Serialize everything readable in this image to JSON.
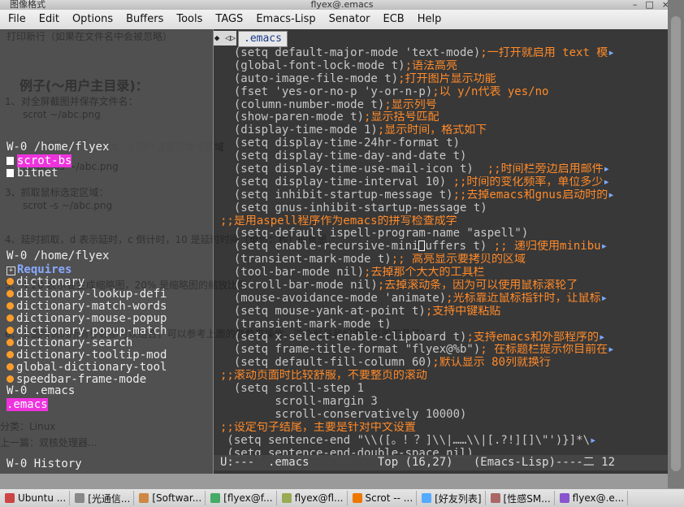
{
  "window": {
    "app_title": "图像格式",
    "title": "flyex@.emacs"
  },
  "menubar": {
    "items": [
      "File",
      "Edit",
      "Options",
      "Buffers",
      "Tools",
      "TAGS",
      "Emacs-Lisp",
      "Senator",
      "ECB",
      "Help"
    ]
  },
  "background": {
    "lines": [
      "打印新行（如果在文件名中会被忽略）",
      "例子(～用户主目录)：",
      "1、对全屏截图并保存文件名：",
      "scrot ~/abc.png",
      "2、截取窗口或带边框窗体，s 用户选择窗体或区域",
      "scrot -bs ~/abc.png",
      "3、抓取鼠标选定区域：",
      "scrot -s ~/abc.png",
      "4、延时抓取，d 表示延时，c 倒计时，10 是延时时间（单位：秒）的意思",
      "5、-t 20 表示要生成缩略图，20% 是缩略图的缩放比例",
      "6、上面所说的所有参数都可以组合，可以参考上面的参数来操作，这个就是我们要的截图工具了！",
      "分类：Linux",
      "上一篇：双核处理器..."
    ]
  },
  "speedbar": {
    "dir_modeline": "W-0 /home/flyex",
    "files": [
      "scrot-bs",
      "bitnet"
    ],
    "dir_modeline2": "W-0 /home/flyex",
    "requires_label": "Requires",
    "requires": [
      "dictionary",
      "dictionary-lookup-defi",
      "dictionary-match-words",
      "dictionary-mouse-popup",
      "dictionary-popup-match",
      "dictionary-search",
      "dictionary-tooltip-mod",
      "global-dictionary-tool",
      "speedbar-frame-mode"
    ],
    "emacs_modeline": "W-0 .emacs",
    "emacs_selected": ".emacs",
    "history_modeline": "W-0 History"
  },
  "editor": {
    "tab_arrows": "◆ ◁▷",
    "buffer_tab": ".emacs",
    "trunc_mark": "▸",
    "lines": [
      {
        "code": "  (setq default-major-mode 'text-mode)",
        "comment": ";一打开就启用 text 模",
        "trunc": true
      },
      {
        "code": "  (global-font-lock-mode t)",
        "comment": ";语法高亮"
      },
      {
        "code": "  (auto-image-file-mode t)",
        "comment": ";打开图片显示功能"
      },
      {
        "code": "  (fset 'yes-or-no-p 'y-or-n-p)",
        "comment": ";以 y/n代表 yes/no"
      },
      {
        "code": "  (column-number-mode t)",
        "comment": ";显示列号"
      },
      {
        "code": "  (show-paren-mode t)",
        "comment": ";显示括号匹配"
      },
      {
        "code": "  (display-time-mode 1)",
        "comment": ";显示时间，格式如下"
      },
      {
        "code": "  (setq display-time-24hr-format t)",
        "comment": ""
      },
      {
        "code": "  (setq display-time-day-and-date t)",
        "comment": ""
      },
      {
        "code": "  (setq display-time-use-mail-icon t)  ",
        "comment": ";;时间栏旁边启用邮件",
        "trunc": true
      },
      {
        "code": "  (setq display-time-interval 10) ",
        "comment": ";;时间的变化频率，单位多少",
        "trunc": true
      },
      {
        "code": "  (setq inhibit-startup-message t)",
        "comment": ";;去掉emacs和gnus启动时的",
        "trunc": true
      },
      {
        "code": "  (setq gnus-inhibit-startup-message t)",
        "comment": ""
      },
      {
        "code": "",
        "comment": ";;是用aspell程序作为emacs的拼写检查成学"
      },
      {
        "code": "  (setq-default ispell-program-name \"aspell\")",
        "comment": ""
      },
      {
        "code": "  (setq enable-recursive-minibuffers t) ",
        "comment": ";; 递归使用minibu",
        "trunc": true,
        "cursor": true
      },
      {
        "code": "  (transient-mark-mode t)",
        "comment": ";; 高亮显示要拷贝的区域"
      },
      {
        "code": "  (tool-bar-mode nil)",
        "comment": ";去掉那个大大的工具栏"
      },
      {
        "code": "  (scroll-bar-mode nil)",
        "comment": ";去掉滚动条，因为可以使用鼠标滚轮了"
      },
      {
        "code": "  (mouse-avoidance-mode 'animate)",
        "comment": ";光标靠近鼠标指针时，让鼠标",
        "trunc": true
      },
      {
        "code": "  (setq mouse-yank-at-point t)",
        "comment": ";支持中键粘贴"
      },
      {
        "code": "  (transient-mark-mode t)",
        "comment": ""
      },
      {
        "code": "  (setq x-select-enable-clipboard t)",
        "comment": ";支持emacs和外部程序的",
        "trunc": true
      },
      {
        "code": "  (setq frame-title-format \"flyex@%b\")",
        "comment": "; 在标题栏提示你目前在",
        "trunc": true
      },
      {
        "code": "  (setq default-fill-column 60)",
        "comment": ";默认显示 80列就换行"
      },
      {
        "code": "",
        "comment": ";;滚动页面时比较舒服，不要整页的滚动"
      },
      {
        "code": "  (setq scroll-step 1",
        "comment": ""
      },
      {
        "code": "        scroll-margin 3",
        "comment": ""
      },
      {
        "code": "        scroll-conservatively 10000)",
        "comment": ""
      },
      {
        "code": "",
        "comment": ";;设定句子结尾，主要是针对中文设置"
      },
      {
        "code": " (setq sentence-end \"\\\\([。！？]\\\\|……\\\\|[.?!][]\\\"')}]*\\",
        "comment": "",
        "trunc": true
      },
      {
        "code": " (setq sentence-end-double-space nil)",
        "comment": ""
      }
    ],
    "modeline": "U:---  .emacs          Top (16,27)   (Emacs-Lisp)----二 12"
  },
  "taskbar": {
    "items": [
      {
        "label": "Ubuntu ...",
        "icon_color": "#c44"
      },
      {
        "label": "[光通信...",
        "icon_color": "#888"
      },
      {
        "label": "[Softwar...",
        "icon_color": "#c84"
      },
      {
        "label": "[flyex@f...",
        "icon_color": "#4a6"
      },
      {
        "label": "flyex@fl...",
        "icon_color": "#9a5"
      },
      {
        "label": "Scrot -- ...",
        "icon_color": "#e70"
      },
      {
        "label": "[好友列表]",
        "icon_color": "#5af"
      },
      {
        "label": "[性感SM...",
        "icon_color": "#a66"
      },
      {
        "label": "flyex@.e...",
        "icon_color": "#85c"
      }
    ]
  }
}
